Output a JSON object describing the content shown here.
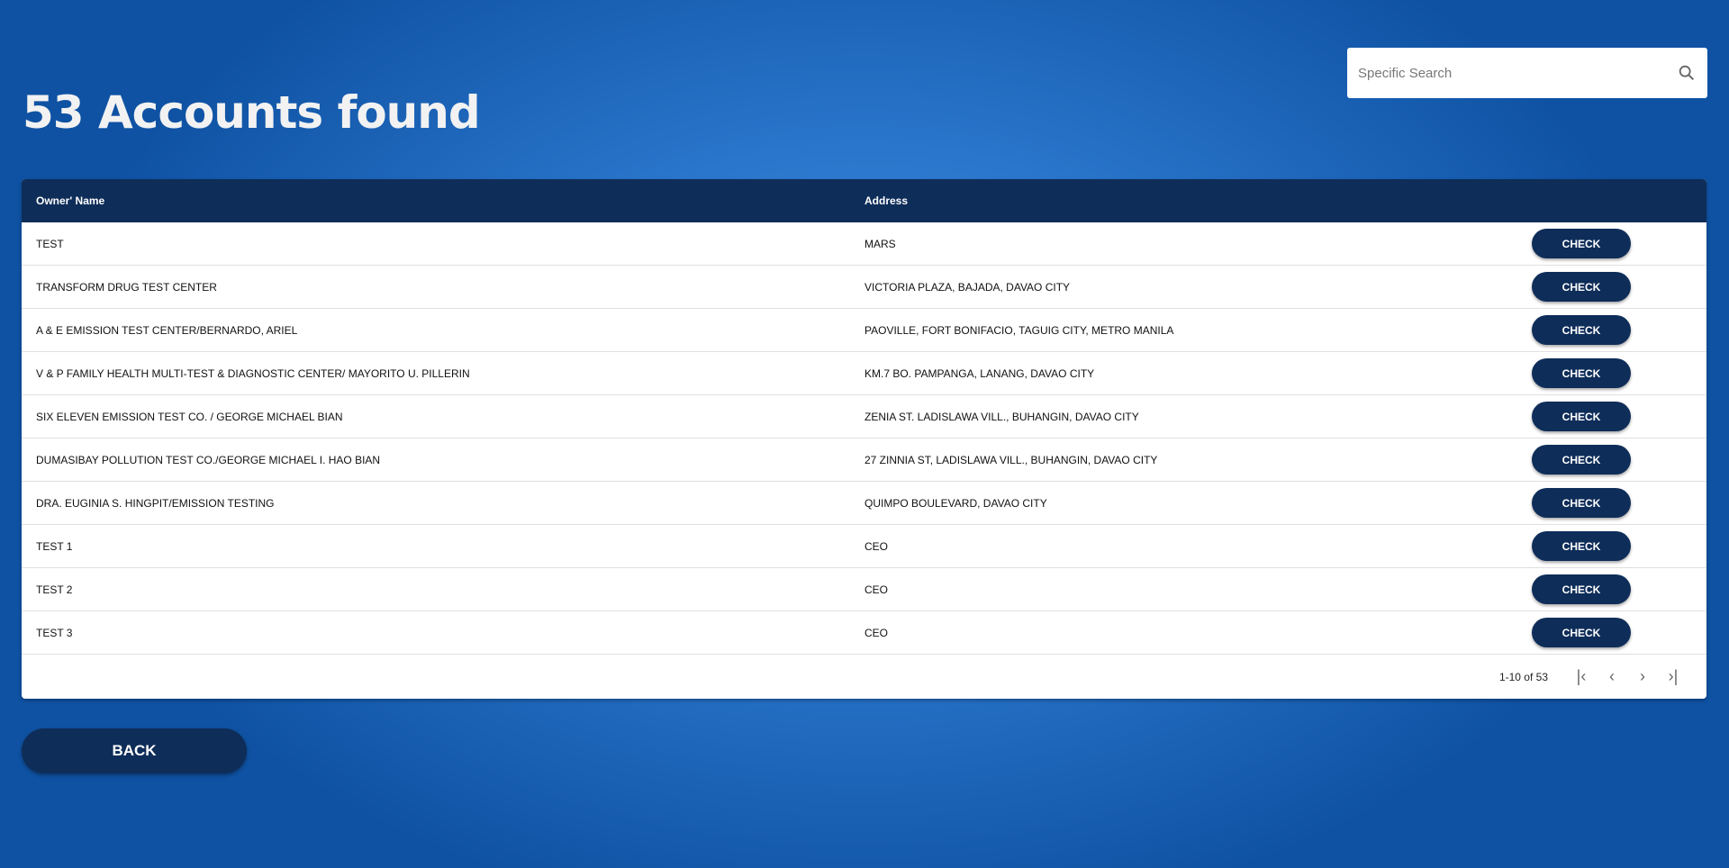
{
  "title": "53 Accounts found",
  "search": {
    "placeholder": "Specific Search",
    "icon": "search-icon"
  },
  "table": {
    "headers": [
      "Owner' Name",
      "Address"
    ],
    "rows": [
      {
        "name": "TEST",
        "address": "MARS",
        "action": "CHECK"
      },
      {
        "name": "TRANSFORM DRUG TEST CENTER",
        "address": "VICTORIA PLAZA, BAJADA, DAVAO CITY",
        "action": "CHECK"
      },
      {
        "name": "A & E EMISSION TEST CENTER/BERNARDO, ARIEL",
        "address": "PAOVILLE, FORT BONIFACIO, TAGUIG CITY, METRO MANILA",
        "action": "CHECK"
      },
      {
        "name": "V & P FAMILY HEALTH MULTI-TEST & DIAGNOSTIC CENTER/ MAYORITO U. PILLERIN",
        "address": "KM.7 BO. PAMPANGA, LANANG, DAVAO CITY",
        "action": "CHECK"
      },
      {
        "name": "SIX ELEVEN EMISSION TEST CO. / GEORGE MICHAEL BIAN",
        "address": "ZENIA ST. LADISLAWA VILL., BUHANGIN, DAVAO CITY",
        "action": "CHECK"
      },
      {
        "name": "DUMASIBAY POLLUTION TEST CO./GEORGE MICHAEL I. HAO BIAN",
        "address": "27 ZINNIA ST, LADISLAWA VILL., BUHANGIN, DAVAO CITY",
        "action": "CHECK"
      },
      {
        "name": "DRA. EUGINIA S. HINGPIT/EMISSION TESTING",
        "address": "QUIMPO BOULEVARD, DAVAO CITY",
        "action": "CHECK"
      },
      {
        "name": "TEST 1",
        "address": "CEO",
        "action": "CHECK"
      },
      {
        "name": "TEST 2",
        "address": "CEO",
        "action": "CHECK"
      },
      {
        "name": "TEST 3",
        "address": "CEO",
        "action": "CHECK"
      }
    ]
  },
  "pagination": {
    "range": "1-10 of 53",
    "first": "|‹",
    "prev": "‹",
    "next": "›",
    "last": "›|"
  },
  "back_label": "BACK",
  "colors": {
    "primary": "#0e2d59",
    "background": "#2a76cc"
  }
}
